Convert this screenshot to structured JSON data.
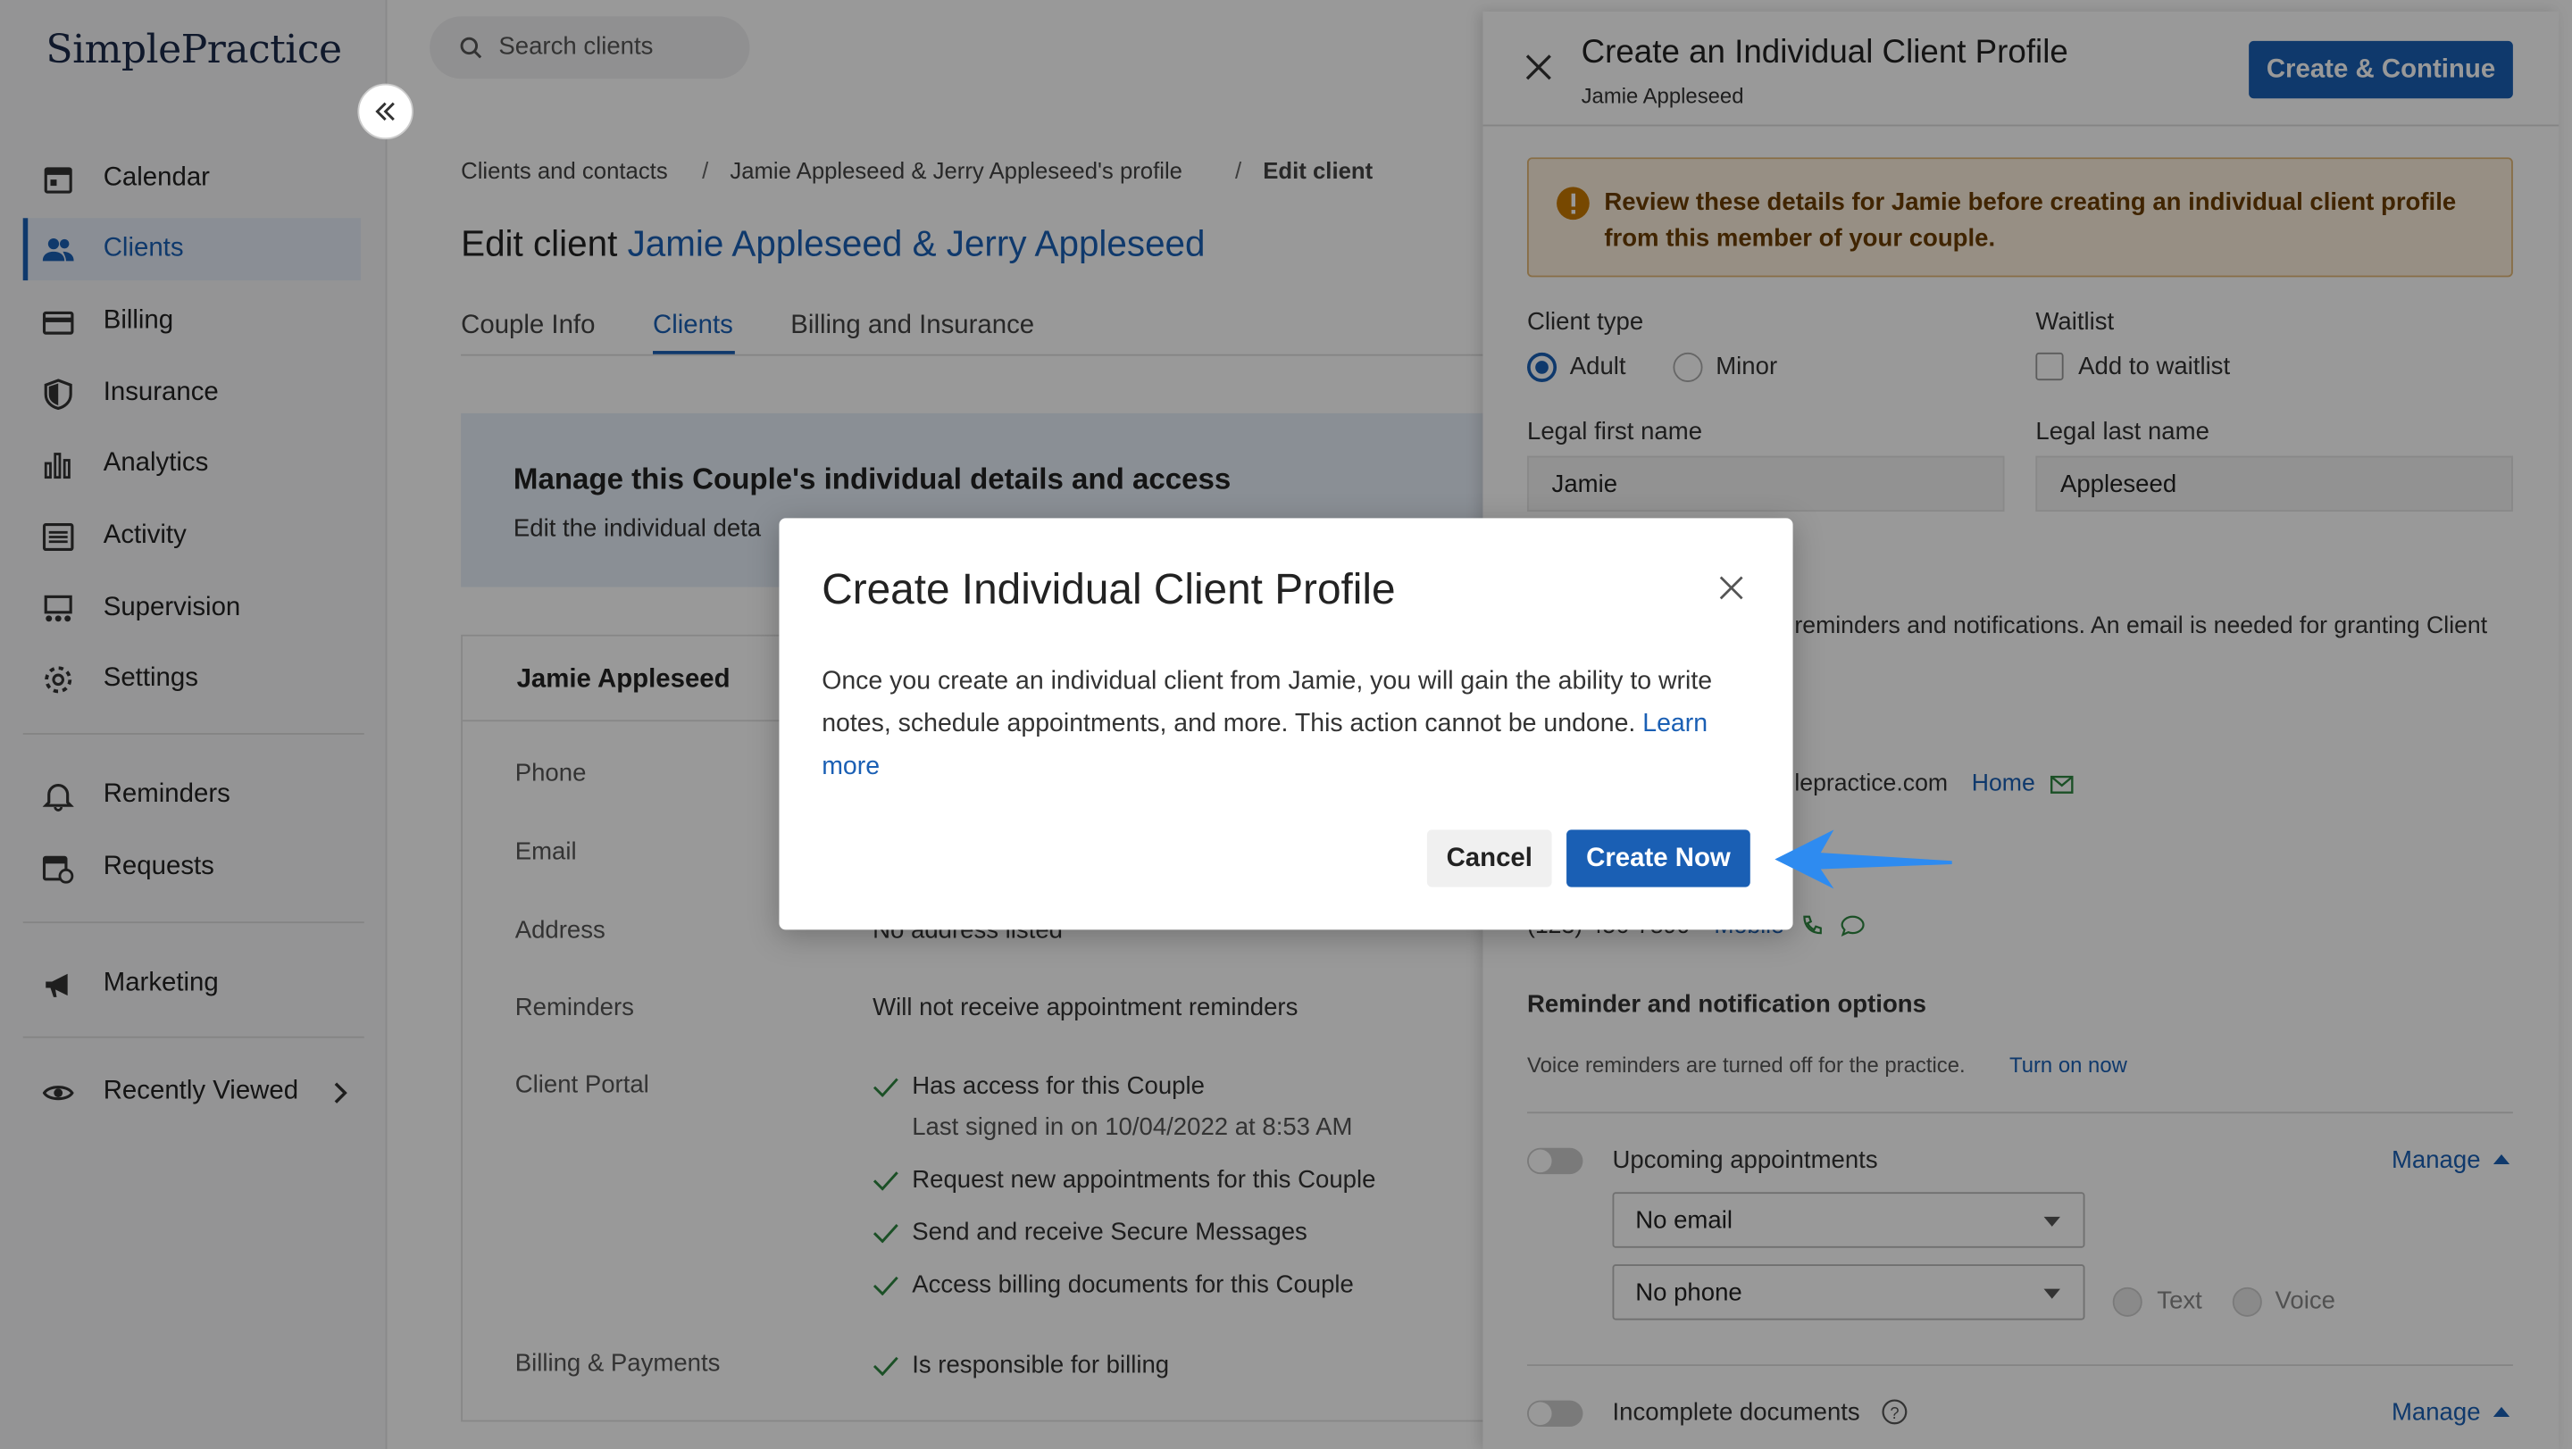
{
  "app": {
    "logo": "SimplePractice"
  },
  "sidebar": {
    "items": [
      {
        "label": "Calendar",
        "icon": "calendar-icon"
      },
      {
        "label": "Clients",
        "icon": "users-icon",
        "active": true
      },
      {
        "label": "Billing",
        "icon": "credit-card-icon"
      },
      {
        "label": "Insurance",
        "icon": "shield-icon"
      },
      {
        "label": "Analytics",
        "icon": "bar-chart-icon"
      },
      {
        "label": "Activity",
        "icon": "list-icon"
      },
      {
        "label": "Supervision",
        "icon": "supervision-icon"
      },
      {
        "label": "Settings",
        "icon": "gear-icon"
      },
      {
        "label": "Reminders",
        "icon": "bell-icon"
      },
      {
        "label": "Requests",
        "icon": "calendar-clock-icon"
      },
      {
        "label": "Marketing",
        "icon": "megaphone-icon"
      },
      {
        "label": "Recently Viewed",
        "icon": "eye-icon"
      }
    ]
  },
  "header": {
    "search_placeholder": "Search clients"
  },
  "breadcrumb": [
    "Clients and contacts",
    "Jamie Appleseed & Jerry Appleseed's profile",
    "Edit client"
  ],
  "page": {
    "title_prefix": "Edit client",
    "title_link": "Jamie Appleseed & Jerry Appleseed",
    "tabs": [
      "Couple Info",
      "Clients",
      "Billing and Insurance"
    ],
    "banner_title": "Manage this Couple's individual details and access",
    "banner_text": "Edit the individual deta",
    "card_title": "Jamie Appleseed",
    "rows": {
      "phone": "Phone",
      "email": "Email",
      "address": "Address",
      "address_value": "No address listed",
      "reminders": "Reminders",
      "reminders_value": "Will not receive appointment reminders",
      "portal": "Client Portal",
      "portal_items": [
        "Has access for this Couple",
        "Request new appointments for this Couple",
        "Send and receive Secure Messages",
        "Access billing documents for this Couple"
      ],
      "portal_signed": "Last signed in on 10/04/2022 at 8:53 AM",
      "billing": "Billing & Payments",
      "billing_value": "Is responsible for billing"
    }
  },
  "panel": {
    "title": "Create an Individual Client Profile",
    "subtitle": "Jamie Appleseed",
    "continue_button": "Create & Continue",
    "alert": "Review these details for Jamie before creating an individual client profile from this member of your couple.",
    "client_type_label": "Client type",
    "client_type_options": [
      "Adult",
      "Minor"
    ],
    "waitlist_label": "Waitlist",
    "waitlist_option": "Add to waitlist",
    "first_name_label": "Legal first name",
    "first_name": "Jamie",
    "last_name_label": "Legal last name",
    "last_name": "Appleseed",
    "email_text_partial": "reminders and notifications. An email is needed for granting Client",
    "email_partial": "lepractice.com",
    "email_type": "Home",
    "phone_partial": "(123) 456-7890",
    "phone_type": "Mobile",
    "reminder_section": "Reminder and notification options",
    "voice_note": "Voice reminders are turned off for the practice.",
    "voice_link": "Turn on now",
    "upcoming_label": "Upcoming appointments",
    "manage": "Manage",
    "email_select": "No email",
    "phone_select": "No phone",
    "text_option": "Text",
    "voice_option": "Voice",
    "incomplete_label": "Incomplete documents"
  },
  "modal": {
    "title": "Create Individual Client Profile",
    "body": "Once you create an individual client from Jamie, you will gain the ability to write notes, schedule appointments, and more. This action cannot be undone.",
    "learn_more": "Learn more",
    "cancel": "Cancel",
    "create": "Create Now"
  },
  "colors": {
    "accent": "#1a5fb4",
    "arrow": "#2e8bf0",
    "alert_bg": "#fcefdc",
    "alert_icon": "#c77800"
  }
}
